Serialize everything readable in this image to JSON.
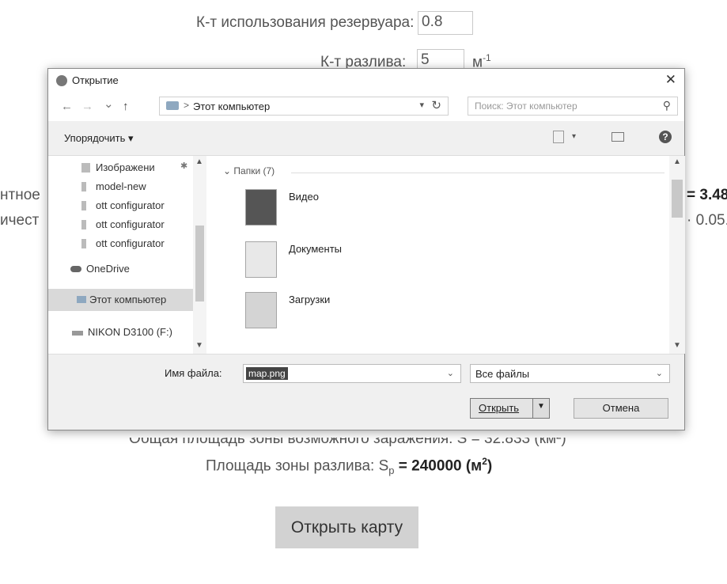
{
  "background": {
    "reservoir_label": "К-т использования резервуара:",
    "reservoir_value": "0.8",
    "spill_label": "К-т разлива:",
    "spill_value": "5",
    "spill_unit": "м",
    "spill_unit_sup": "-1",
    "left_frag_1": "нтное",
    "left_frag_2": "ичест",
    "right_frag_1": "= 3.48",
    "right_frag_2": "· 0.05.",
    "total_area_text": "Общая площадь зоны возможного заражения: S = 32.833 (км²)",
    "spill_area_label": "Площадь зоны разлива: S",
    "spill_area_sub": "p",
    "spill_area_value": "= 240000 (м",
    "spill_area_sup": "2",
    "spill_area_close": ")",
    "open_map_button": "Открыть карту"
  },
  "dialog": {
    "title": "Открытие",
    "close_glyph": "✕",
    "nav": {
      "back": "←",
      "forward": "→",
      "recent": "⌄",
      "up": "↑"
    },
    "address_sep": ">",
    "address": "Этот компьютер",
    "search_placeholder": "Поиск: Этот компьютер",
    "organize": "Упорядочить ▾",
    "help": "?",
    "left_nav": [
      {
        "label": "Изображени"
      },
      {
        "label": "model-new"
      },
      {
        "label": "ott configurator"
      },
      {
        "label": "ott configurator"
      },
      {
        "label": "ott configurator"
      },
      {
        "label": "OneDrive"
      },
      {
        "label": "Этот компьютер"
      },
      {
        "label": "NIKON D3100 (F:)"
      }
    ],
    "folders_header": "Папки (7)",
    "folders": [
      {
        "name": "Видео"
      },
      {
        "name": "Документы"
      },
      {
        "name": "Загрузки"
      }
    ],
    "filename_label": "Имя файла:",
    "filename_value": "map.png",
    "filter": "Все файлы",
    "open_button": "Открыть",
    "cancel_button": "Отмена"
  }
}
